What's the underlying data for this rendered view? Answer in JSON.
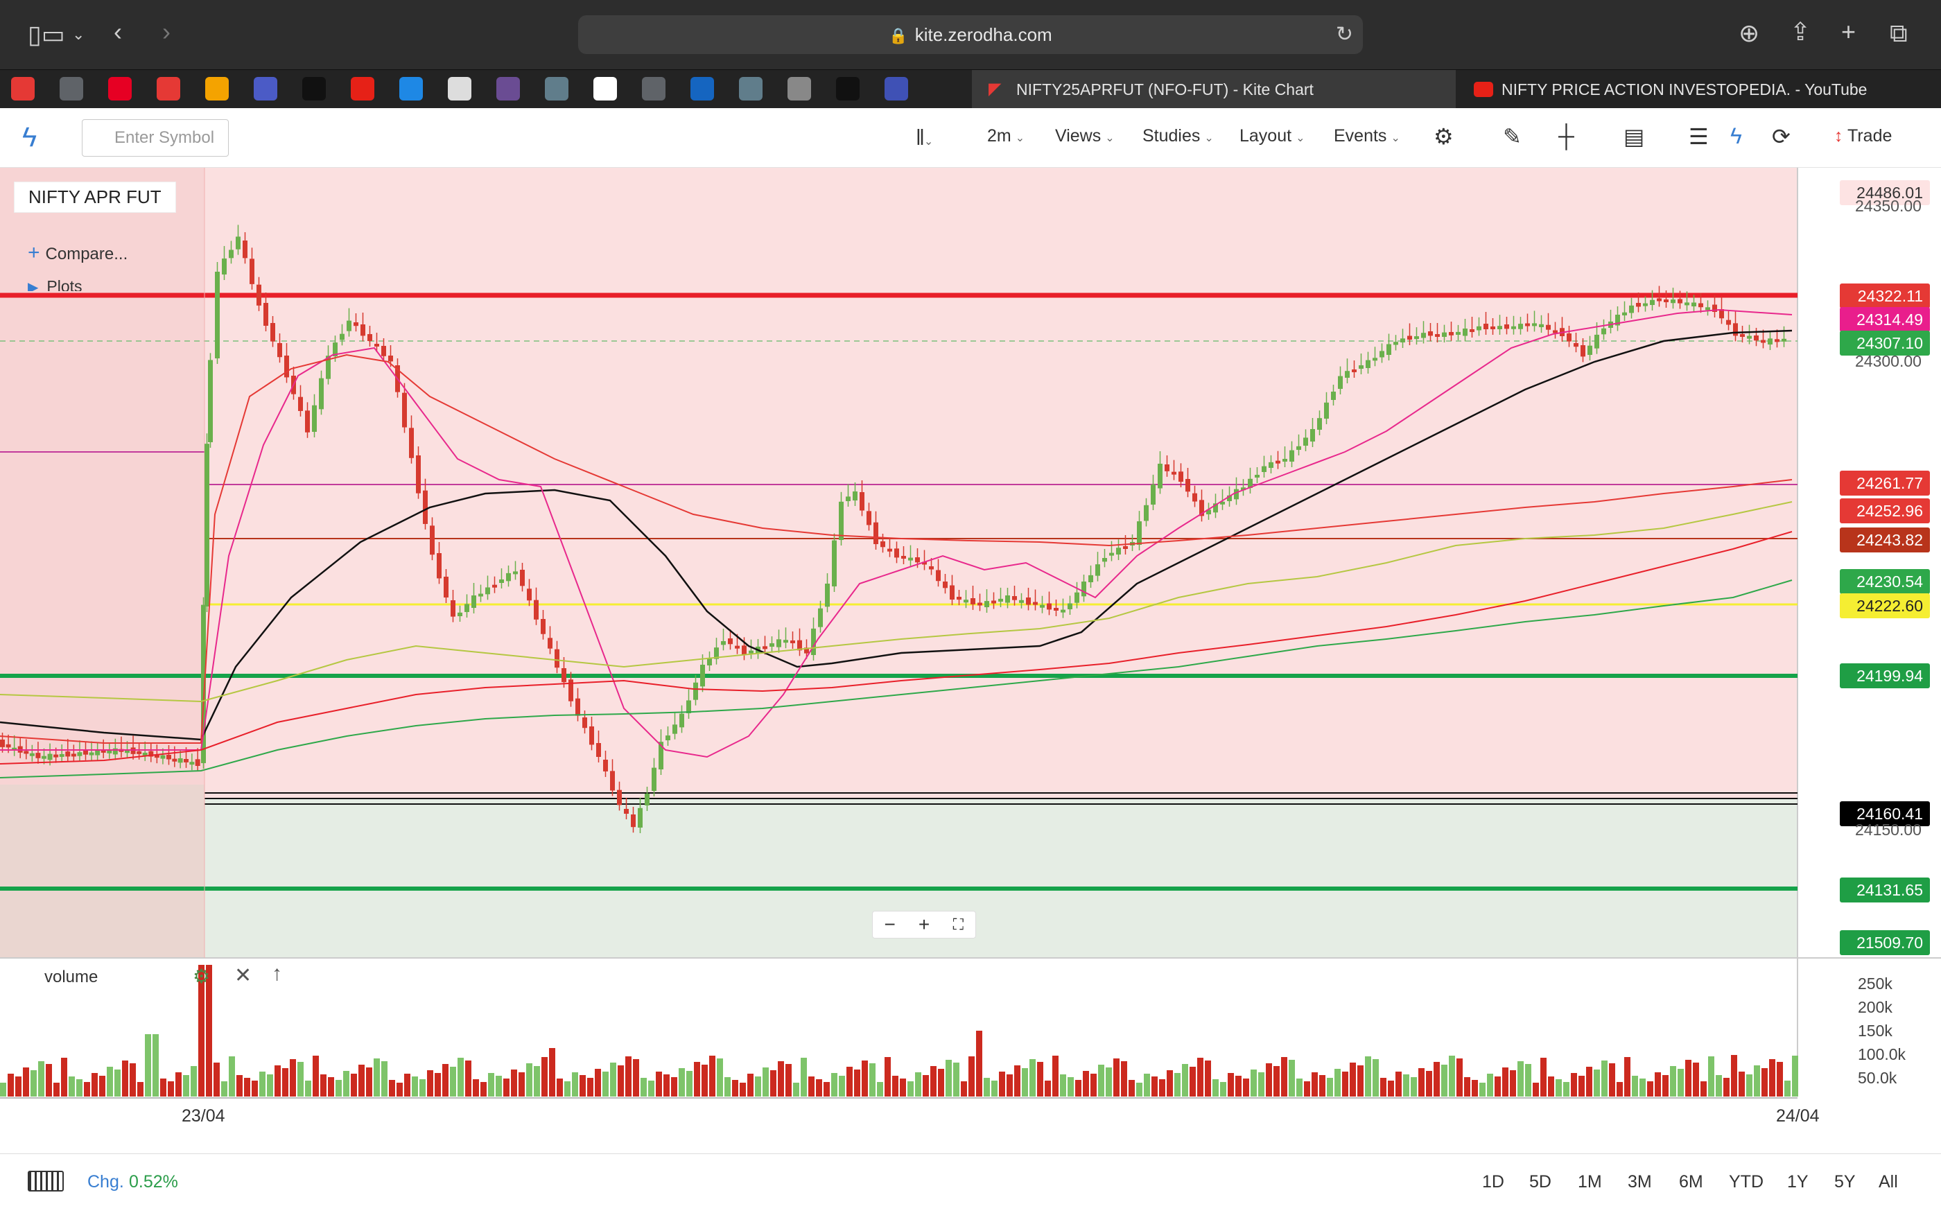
{
  "browser": {
    "url": "kite.zerodha.com",
    "tabs": [
      {
        "label": "NIFTY25APRFUT (NFO-FUT) - Kite Chart"
      },
      {
        "label": "NIFTY PRICE ACTION INVESTOPEDIA. - YouTube"
      }
    ],
    "favorites": [
      "G",
      "P",
      "K",
      "chart",
      "S",
      "gpt",
      "yt",
      "CI",
      "swirl",
      "art",
      "bag",
      "news",
      "G",
      "N",
      "bag",
      "W",
      "gpt",
      "wave",
      "yt"
    ]
  },
  "toolbar": {
    "symbol_placeholder": "Enter Symbol",
    "interval": "2m",
    "views": "Views",
    "studies": "Studies",
    "layout": "Layout",
    "events": "Events",
    "trade": "Trade"
  },
  "chart": {
    "symbol": "NIFTY APR FUT",
    "compare": "Compare...",
    "plots": "Plots",
    "price_labels": [
      "24486.01",
      "24322.11",
      "24314.49",
      "24307.10",
      "24261.77",
      "24252.96",
      "24243.82",
      "24230.54",
      "24222.60",
      "24199.94",
      "24160.41",
      "24131.65",
      "21509.70"
    ],
    "axis_labels": [
      "24350.00",
      "24300.00",
      "24150.00"
    ],
    "colors": {
      "up": "#6ab04c",
      "down": "#d63a2f",
      "accent": "#387ed1"
    }
  },
  "volume": {
    "label": "volume",
    "axis_labels": [
      "250k",
      "200k",
      "150k",
      "100.0k",
      "50.0k"
    ]
  },
  "dates": [
    "23/04",
    "24/04"
  ],
  "bottom": {
    "chg_label": "Chg.",
    "chg_value": "0.52%",
    "ranges": [
      "1D",
      "5D",
      "1M",
      "3M",
      "6M",
      "YTD",
      "1Y",
      "5Y",
      "All"
    ]
  }
}
